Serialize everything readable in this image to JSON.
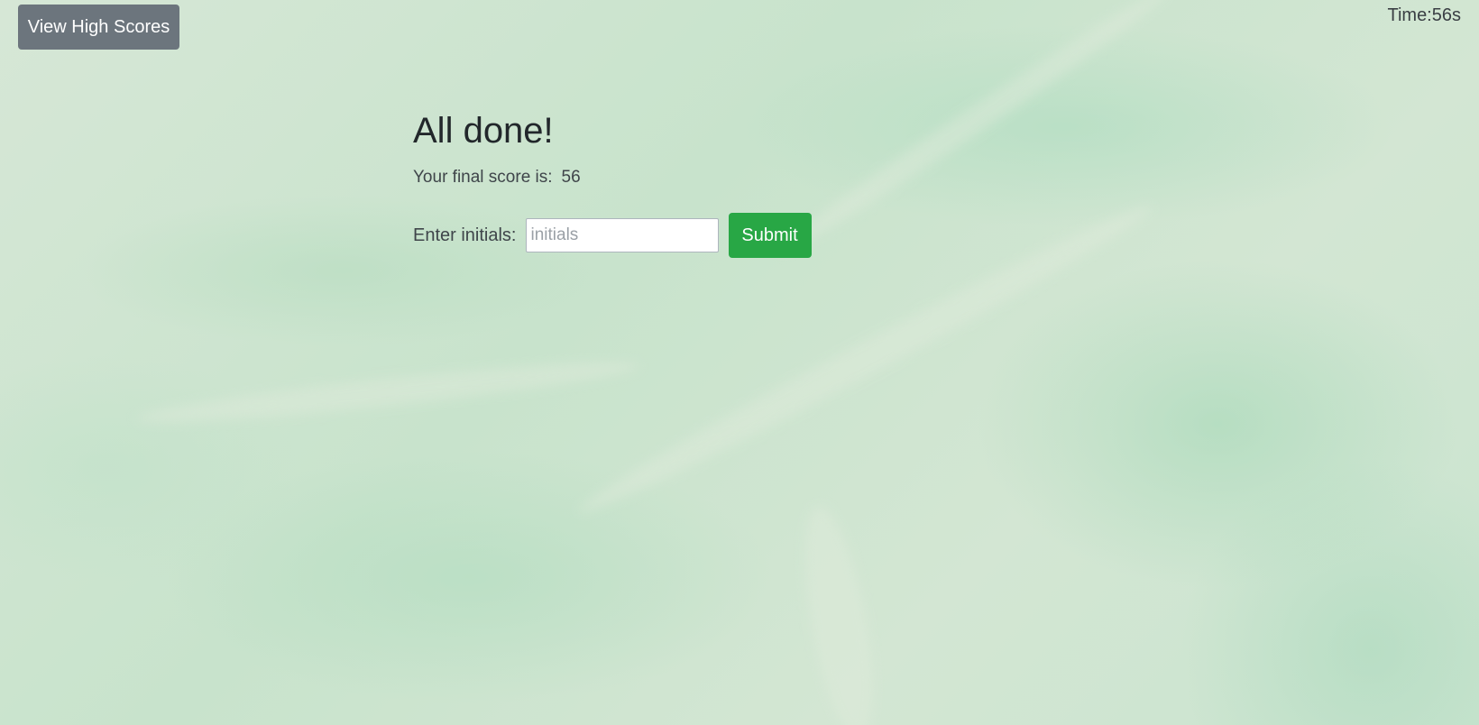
{
  "header": {
    "high_scores_label": "View High Scores",
    "timer_text": "Time:56s"
  },
  "result": {
    "title": "All done!",
    "score_label": "Your final score is:",
    "score_value": "56"
  },
  "form": {
    "initials_label": "Enter initials:",
    "initials_placeholder": "initials",
    "initials_value": "",
    "submit_label": "Submit"
  },
  "colors": {
    "secondary_button": "#6c757d",
    "success_button": "#28a745",
    "background": "#cfe3d0"
  }
}
